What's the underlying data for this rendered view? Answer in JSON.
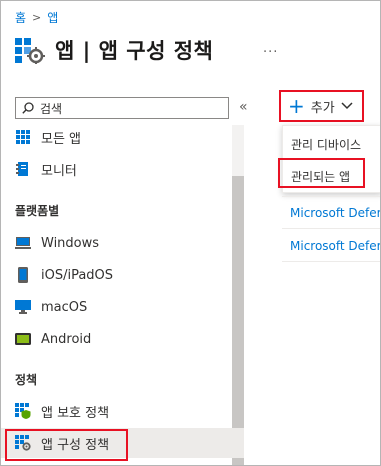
{
  "breadcrumb": {
    "home": "홈",
    "separator": ">",
    "current": "앱"
  },
  "header": {
    "title": "앱 | 앱 구성 정책",
    "more": "..."
  },
  "search": {
    "placeholder": "검색",
    "collapse": "«"
  },
  "sidebar": {
    "items_top": [
      {
        "label": "모든 앱",
        "icon": "all-apps-grid-icon"
      },
      {
        "label": "모니터",
        "icon": "monitor-book-icon"
      }
    ],
    "platform_section": "플랫폼별",
    "platform_items": [
      {
        "label": "Windows",
        "icon": "windows-device-icon"
      },
      {
        "label": "iOS/iPadOS",
        "icon": "ios-phone-icon"
      },
      {
        "label": "macOS",
        "icon": "macos-monitor-icon"
      },
      {
        "label": "Android",
        "icon": "android-device-icon"
      }
    ],
    "policy_section": "정책",
    "policy_items": [
      {
        "label": "앱 보호 정책",
        "icon": "app-protection-icon"
      },
      {
        "label": "앱 구성 정책",
        "icon": "app-config-icon"
      }
    ]
  },
  "toolbar": {
    "add_label": "추가",
    "add_icon": "plus-icon",
    "chevron": "chevron-down-icon"
  },
  "dropdown": {
    "items": [
      "관리 디바이스",
      "관리되는 앱"
    ]
  },
  "table": {
    "rows": [
      "Microsoft Defer",
      "Microsoft Defer"
    ]
  },
  "colors": {
    "accent": "#0078d4",
    "highlight": "#e81123",
    "active_bg": "#edebe9"
  }
}
